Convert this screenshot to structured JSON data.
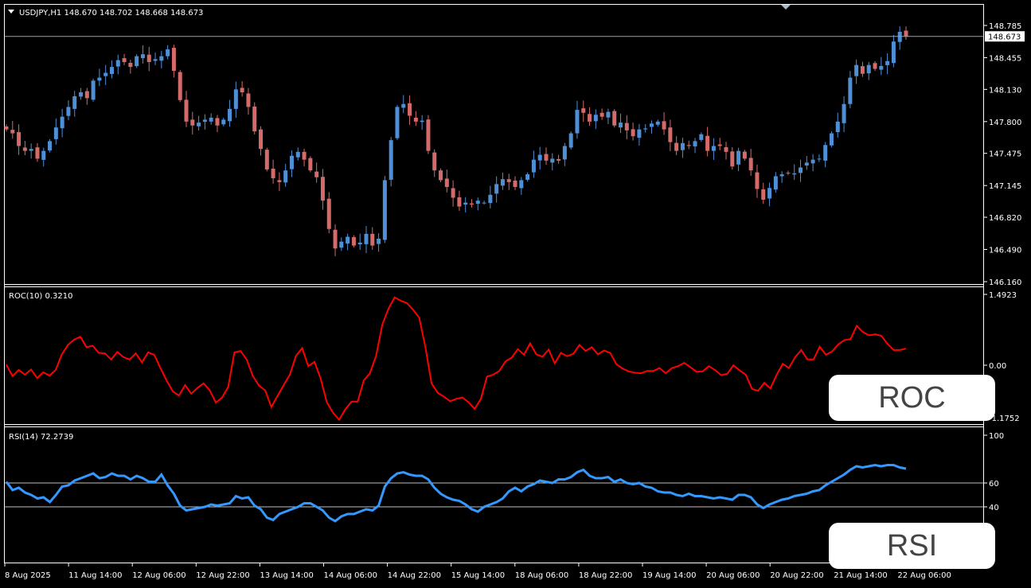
{
  "colors": {
    "background": "#000000",
    "frame": "#ffffff",
    "bull": "#4f8fd6",
    "bear": "#d56a6a",
    "roc_line": "#ff0000",
    "rsi_line": "#3399ff",
    "level_line": "#c0c0c0"
  },
  "icons": {
    "symbol_menu": "triangle-down-icon",
    "shift_marker": "triangle-down-icon"
  },
  "overlays": {
    "roc_label": "ROC",
    "rsi_label": "RSI"
  },
  "chart_data": [
    {
      "type": "candlestick",
      "title": "USDJPY,H1  148.670 148.702 148.668 148.673",
      "current_price": 148.673,
      "current_price_label": "148.673",
      "ylim": [
        146.1,
        148.83
      ],
      "y_ticks": [
        "148.785",
        "148.455",
        "148.130",
        "147.800",
        "147.475",
        "147.145",
        "146.820",
        "146.490",
        "146.160"
      ],
      "close": [
        147.72,
        147.68,
        147.55,
        147.5,
        147.52,
        147.42,
        147.5,
        147.6,
        147.74,
        147.85,
        147.95,
        148.06,
        148.1,
        148.04,
        148.22,
        148.25,
        148.3,
        148.36,
        148.43,
        148.41,
        148.36,
        148.47,
        148.49,
        148.41,
        148.44,
        148.47,
        148.54,
        148.32,
        148.02,
        147.8,
        147.76,
        147.79,
        147.82,
        147.84,
        147.76,
        147.82,
        147.93,
        148.13,
        148.1,
        147.95,
        147.7,
        147.52,
        147.31,
        147.22,
        147.18,
        147.3,
        147.45,
        147.49,
        147.41,
        147.3,
        147.23,
        146.99,
        146.7,
        146.5,
        146.57,
        146.62,
        146.53,
        146.56,
        146.65,
        146.53,
        146.6,
        147.2,
        147.61,
        147.95,
        147.98,
        147.86,
        147.8,
        147.81,
        147.5,
        147.3,
        147.2,
        147.13,
        147.02,
        146.93,
        146.97,
        146.95,
        146.99,
        146.97,
        147.05,
        147.16,
        147.21,
        147.18,
        147.13,
        147.2,
        147.26,
        147.41,
        147.46,
        147.4,
        147.42,
        147.4,
        147.55,
        147.68,
        147.92,
        147.89,
        147.8,
        147.87,
        147.85,
        147.9,
        147.76,
        147.79,
        147.71,
        147.65,
        147.72,
        147.73,
        147.78,
        147.8,
        147.72,
        147.59,
        147.5,
        147.58,
        147.55,
        147.6,
        147.67,
        147.5,
        147.55,
        147.55,
        147.49,
        147.34,
        147.5,
        147.42,
        147.3,
        147.11,
        147.0,
        147.12,
        147.24,
        147.26,
        147.27,
        147.27,
        147.33,
        147.38,
        147.41,
        147.42,
        147.56,
        147.68,
        147.8,
        147.98,
        148.25,
        148.38,
        148.29,
        148.38,
        148.34,
        148.37,
        148.42,
        148.62,
        148.72,
        148.67
      ]
    },
    {
      "type": "line",
      "title": "ROC(10) 0.3210",
      "series": [
        {
          "name": "ROC(10)",
          "values": [
            0.01,
            -0.23,
            -0.1,
            -0.2,
            -0.09,
            -0.27,
            -0.15,
            -0.22,
            -0.1,
            0.23,
            0.43,
            0.54,
            0.6,
            0.38,
            0.41,
            0.26,
            0.25,
            0.12,
            0.28,
            0.17,
            0.12,
            0.25,
            0.06,
            0.27,
            0.22,
            -0.06,
            -0.32,
            -0.55,
            -0.64,
            -0.42,
            -0.6,
            -0.48,
            -0.38,
            -0.53,
            -0.79,
            -0.68,
            -0.46,
            0.27,
            0.3,
            0.12,
            -0.23,
            -0.43,
            -0.53,
            -0.88,
            -0.65,
            -0.42,
            -0.2,
            0.2,
            0.36,
            -0.02,
            0.07,
            -0.28,
            -0.78,
            -1.0,
            -1.15,
            -0.93,
            -0.77,
            -0.77,
            -0.32,
            -0.17,
            0.2,
            0.85,
            1.19,
            1.43,
            1.36,
            1.31,
            1.17,
            1.0,
            0.38,
            -0.38,
            -0.58,
            -0.66,
            -0.76,
            -0.71,
            -0.68,
            -0.78,
            -0.92,
            -0.71,
            -0.24,
            -0.2,
            -0.12,
            0.08,
            0.16,
            0.34,
            0.22,
            0.46,
            0.23,
            0.18,
            0.33,
            0.04,
            0.26,
            0.19,
            0.24,
            0.43,
            0.3,
            0.38,
            0.23,
            0.31,
            0.26,
            0.02,
            -0.07,
            -0.13,
            -0.16,
            -0.17,
            -0.12,
            -0.12,
            -0.06,
            -0.17,
            -0.06,
            -0.02,
            0.05,
            -0.04,
            -0.14,
            -0.13,
            -0.02,
            -0.1,
            -0.21,
            -0.18,
            0.0,
            -0.11,
            -0.2,
            -0.5,
            -0.54,
            -0.37,
            -0.49,
            -0.2,
            0.03,
            -0.06,
            0.17,
            0.32,
            0.12,
            0.12,
            0.39,
            0.22,
            0.29,
            0.44,
            0.53,
            0.55,
            0.83,
            0.7,
            0.63,
            0.65,
            0.62,
            0.45,
            0.32,
            0.32,
            0.35
          ]
        }
      ],
      "ylim": [
        -1.1752,
        1.4923
      ],
      "y_ticks": [
        "1.4923",
        "0.00",
        "-1.1752"
      ]
    },
    {
      "type": "line",
      "title": "RSI(14) 72.2739",
      "series": [
        {
          "name": "RSI(14)",
          "values": [
            61,
            54,
            56,
            52,
            50,
            47,
            48,
            44,
            50,
            57,
            58,
            62,
            64,
            66,
            68,
            64,
            65,
            68,
            66,
            66,
            63,
            66,
            64,
            61,
            61,
            67,
            58,
            51,
            41,
            37,
            38,
            39,
            40,
            42,
            41,
            42,
            43,
            49,
            47,
            48,
            41,
            38,
            31,
            29,
            34,
            36,
            38,
            40,
            43,
            43,
            40,
            37,
            31,
            28,
            32,
            34,
            34,
            36,
            38,
            37,
            41,
            57,
            64,
            68,
            69,
            67,
            66,
            66,
            63,
            56,
            51,
            48,
            46,
            45,
            42,
            38,
            36,
            40,
            42,
            44,
            47,
            53,
            56,
            53,
            57,
            59,
            62,
            61,
            60,
            63,
            63,
            65,
            69,
            71,
            66,
            64,
            64,
            65,
            61,
            63,
            60,
            59,
            60,
            57,
            56,
            53,
            52,
            52,
            50,
            49,
            51,
            49,
            49,
            48,
            47,
            48,
            47,
            46,
            50,
            50,
            48,
            42,
            39,
            42,
            44,
            46,
            47,
            49,
            50,
            51,
            53,
            54,
            58,
            61,
            64,
            67,
            71,
            74,
            73,
            74,
            75,
            74,
            75,
            75,
            73,
            72
          ]
        }
      ],
      "ylim": [
        0,
        100
      ],
      "y_ticks": [
        "100",
        "60",
        "40"
      ],
      "levels": [
        60,
        40
      ]
    }
  ],
  "x_axis": {
    "tick_labels": [
      "8 Aug 2025",
      "11 Aug 14:00",
      "12 Aug 06:00",
      "12 Aug 22:00",
      "13 Aug 14:00",
      "14 Aug 06:00",
      "14 Aug 22:00",
      "15 Aug 14:00",
      "18 Aug 06:00",
      "18 Aug 22:00",
      "19 Aug 14:00",
      "20 Aug 06:00",
      "20 Aug 22:00",
      "21 Aug 14:00",
      "22 Aug 06:00"
    ]
  }
}
